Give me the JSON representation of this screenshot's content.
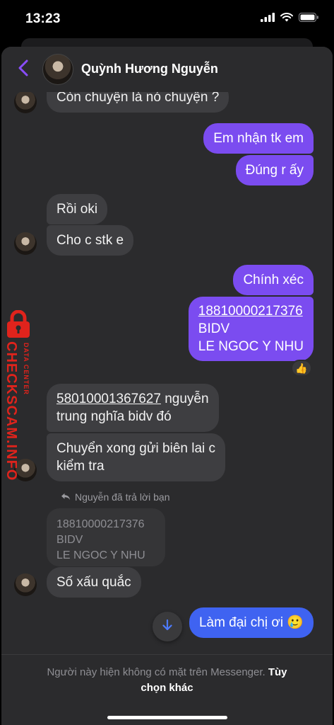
{
  "status_bar": {
    "time": "13:23"
  },
  "header": {
    "contact_name": "Quỳnh Hương Nguyễn"
  },
  "messages": {
    "m1": "Còn chuyện là nó chuyện ?",
    "m2": "Em nhận tk em",
    "m3": "Đúng r ấy",
    "m4": "Rồi oki",
    "m5": "Cho c stk e",
    "m6": "Chính xéc",
    "m7_line1": "18810000217376",
    "m7_line2": "BIDV",
    "m7_line3": "LE NGOC Y NHU",
    "m7_reaction": "👍",
    "m8_account": "58010001367627",
    "m8_rest1": " nguyễn",
    "m8_line2": "trung nghĩa bidv đó",
    "m9_line1": "Chuyển xong gửi biên lai c",
    "m9_line2": "kiểm tra",
    "reply_meta": "Nguyễn đã trả lời bạn",
    "quoted_line1": "18810000217376",
    "quoted_line2": "BIDV",
    "quoted_line3": "LE NGOC Y NHU",
    "m10": "Số xấu quắc",
    "m11": "Làm đại chị ơi 🥲"
  },
  "footer": {
    "notice": "Người này hiện không có mặt trên Messenger. ",
    "link_part1": "Tùy",
    "link_part2": "chọn khác"
  },
  "watermark": {
    "main": "CHECKSCAM.INFO",
    "sub": "DATA CENTER"
  },
  "colors": {
    "accent_purple": "#7b4cf0",
    "accent_blue": "#3f63f1",
    "incoming": "#3e3e41",
    "watermark_red": "#e0231c"
  },
  "icons": [
    "back-chevron-icon",
    "signal-icon",
    "wifi-icon",
    "battery-icon",
    "reply-arrow-icon",
    "arrow-down-icon",
    "lock-icon"
  ]
}
